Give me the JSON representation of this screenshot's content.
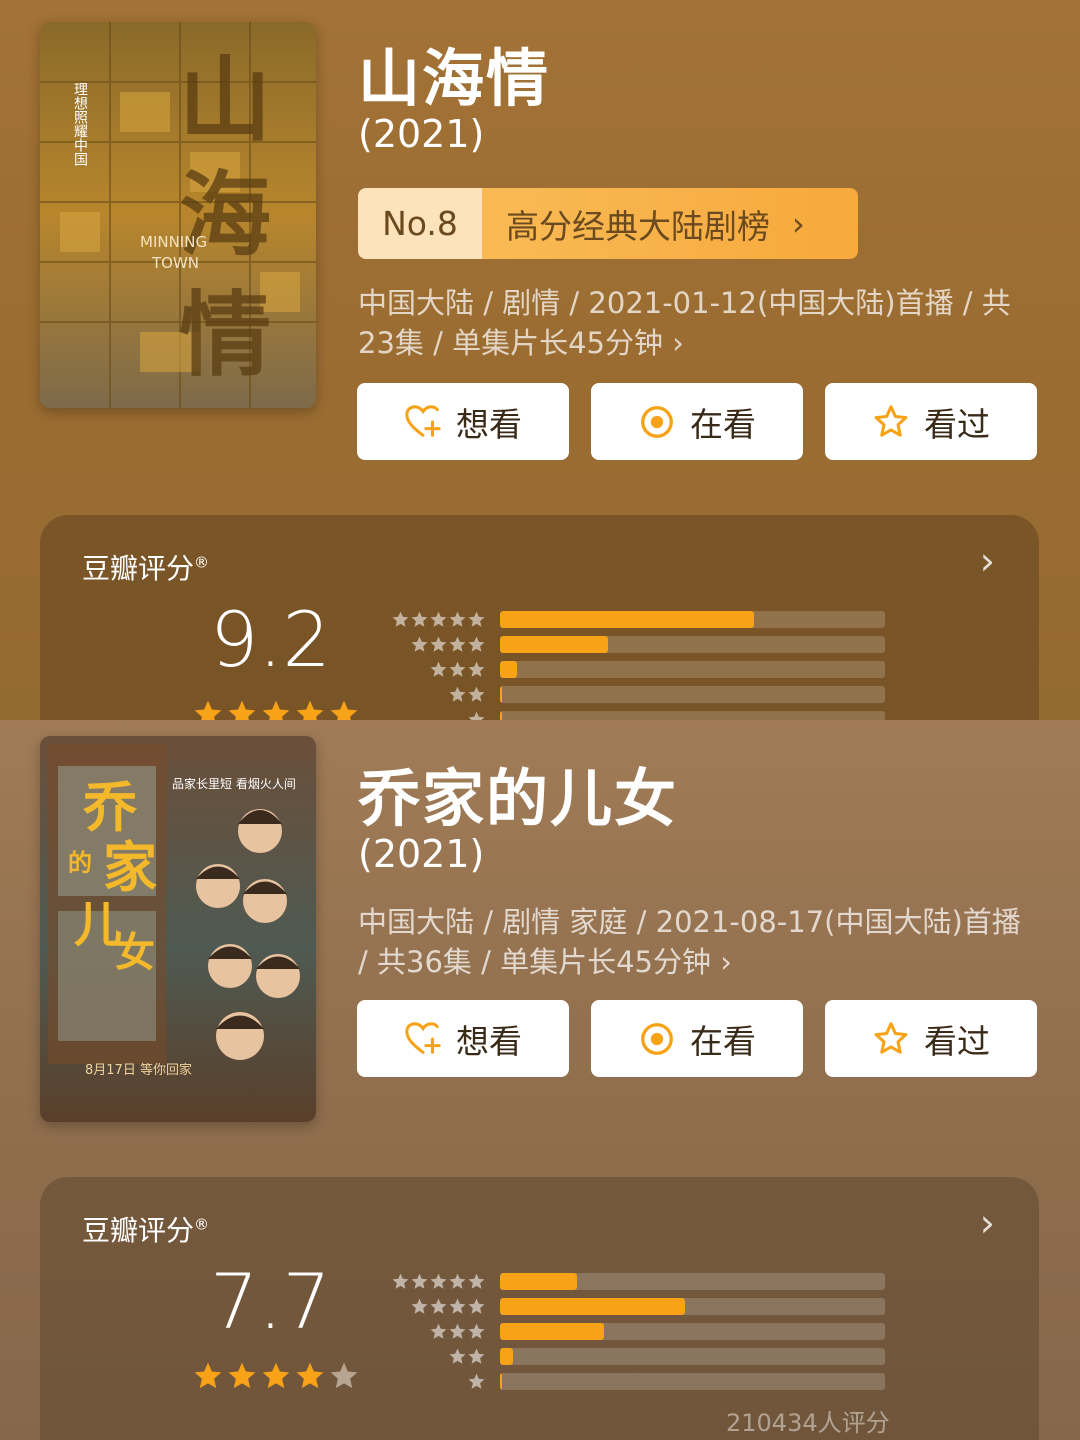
{
  "colors": {
    "accent": "#f7a217",
    "star_active": "#f7a217",
    "star_inactive": "#b8a591"
  },
  "shows": [
    {
      "title": "山海情",
      "year": "(2021)",
      "rank": {
        "no": "No.8",
        "name": "高分经典大陆剧榜",
        "chevron": "›"
      },
      "meta_text": "中国大陆 / 剧情 / 2021-01-12(中国大陆)首播 / 共23集 / 单集片长45分钟 ›",
      "poster": {
        "image_text": "山海情",
        "slogan": "理想照耀中国",
        "english": "MINNING TOWN"
      },
      "actions": {
        "want": "想看",
        "watching": "在看",
        "watched": "看过"
      },
      "rating": {
        "label": "豆瓣评分",
        "mark": "®",
        "score": "9.2",
        "star_level": 5,
        "distribution": [
          0.66,
          0.28,
          0.045,
          0.005,
          0.001
        ],
        "count": ""
      }
    },
    {
      "title": "乔家的儿女",
      "year": "(2021)",
      "meta_text": "中国大陆 / 剧情 家庭 / 2021-08-17(中国大陆)首播 / 共36集 / 单集片长45分钟 ›",
      "poster": {
        "image_text": "乔家的儿女",
        "slogan": "品家长里短  看烟火人间",
        "date": "8月17日 等你回家"
      },
      "actions": {
        "want": "想看",
        "watching": "在看",
        "watched": "看过"
      },
      "rating": {
        "label": "豆瓣评分",
        "mark": "®",
        "score": "7.7",
        "star_level": 4,
        "distribution": [
          0.2,
          0.48,
          0.27,
          0.035,
          0.006
        ],
        "count": "210434人评分"
      }
    }
  ]
}
